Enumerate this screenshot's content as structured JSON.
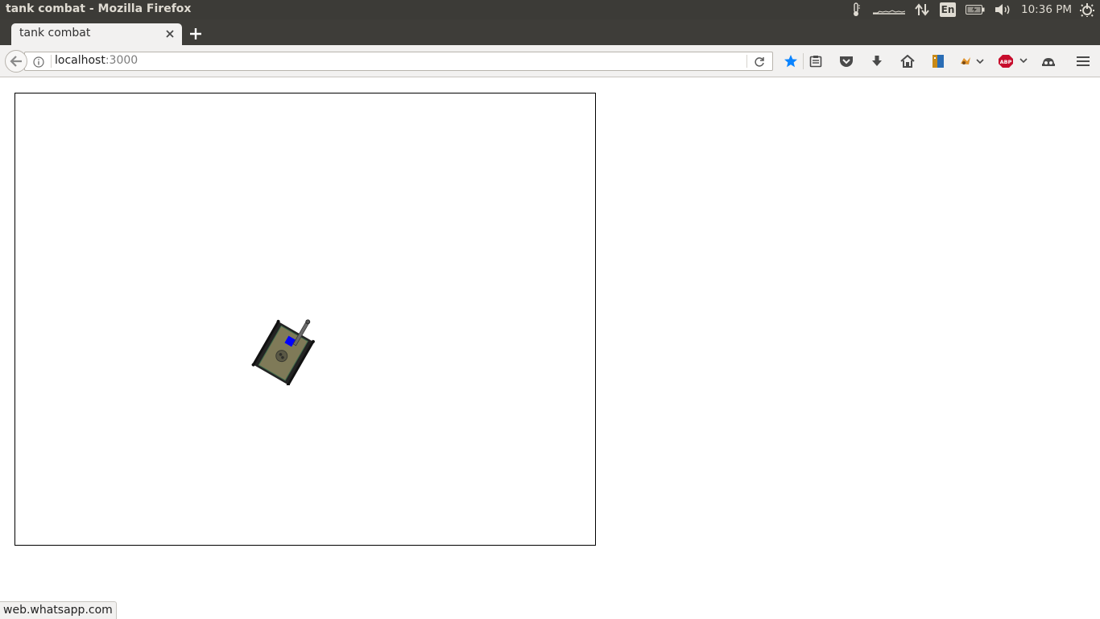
{
  "window": {
    "title": "tank combat - Mozilla Firefox"
  },
  "system_tray": {
    "language": "En",
    "clock": "10:36 PM"
  },
  "tabs": [
    {
      "label": "tank combat",
      "active": true
    }
  ],
  "address_bar": {
    "host": "localhost",
    "port": ":3000"
  },
  "toolbar": {
    "icons": [
      "star-icon",
      "reading-list-icon",
      "pocket-icon",
      "download-icon",
      "home-icon",
      "bookmark-menu-icon",
      "extension-icon",
      "adblock-icon",
      "sync-icon",
      "menu-icon"
    ],
    "adblock_label": "ABP",
    "accent": "#0a84ff"
  },
  "page": {
    "game": {
      "player_color": "#0000ff",
      "hull_color": "#7f7a58"
    }
  },
  "status": {
    "link": "web.whatsapp.com"
  }
}
